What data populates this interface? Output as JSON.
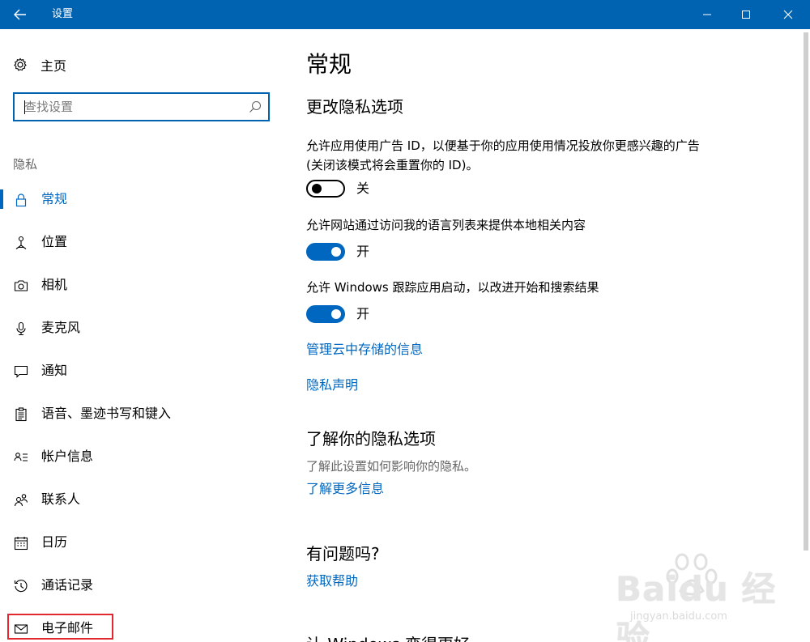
{
  "window": {
    "title": "设置"
  },
  "sidebar": {
    "home_label": "主页",
    "search_placeholder": "查找设置",
    "section_label": "隐私",
    "items": [
      {
        "label": "常规",
        "icon": "lock-icon",
        "selected": true
      },
      {
        "label": "位置",
        "icon": "location-icon",
        "selected": false
      },
      {
        "label": "相机",
        "icon": "camera-icon",
        "selected": false
      },
      {
        "label": "麦克风",
        "icon": "microphone-icon",
        "selected": false
      },
      {
        "label": "通知",
        "icon": "notification-icon",
        "selected": false
      },
      {
        "label": "语音、墨迹书写和键入",
        "icon": "speech-ink-typing-icon",
        "selected": false
      },
      {
        "label": "帐户信息",
        "icon": "account-info-icon",
        "selected": false
      },
      {
        "label": "联系人",
        "icon": "contacts-icon",
        "selected": false
      },
      {
        "label": "日历",
        "icon": "calendar-icon",
        "selected": false
      },
      {
        "label": "通话记录",
        "icon": "call-history-icon",
        "selected": false
      },
      {
        "label": "电子邮件",
        "icon": "email-icon",
        "selected": false,
        "highlighted": true
      }
    ]
  },
  "main": {
    "page_title": "常规",
    "section1_title": "更改隐私选项",
    "options": [
      {
        "description": "允许应用使用广告 ID，以便基于你的应用使用情况投放你更感兴趣的广告(关闭该模式将会重置你的 ID)。",
        "state_label": "关",
        "on": false
      },
      {
        "description": "允许网站通过访问我的语言列表来提供本地相关内容",
        "state_label": "开",
        "on": true
      },
      {
        "description": "允许 Windows 跟踪应用启动，以改进开始和搜索结果",
        "state_label": "开",
        "on": true
      }
    ],
    "link_cloud": "管理云中存储的信息",
    "link_privacy_statement": "隐私声明",
    "section2_title": "了解你的隐私选项",
    "section2_desc": "了解此设置如何影响你的隐私。",
    "link_learn_more": "了解更多信息",
    "section3_title": "有问题吗?",
    "link_get_help": "获取帮助",
    "section4_title": "让 Windows 变得更好"
  },
  "watermark": {
    "brand": "Baidu 经验",
    "site": "jingyan.baidu.com"
  },
  "colors": {
    "titlebar": "#0063b1",
    "accent": "#0067c0",
    "highlight_box": "#e0282e"
  }
}
